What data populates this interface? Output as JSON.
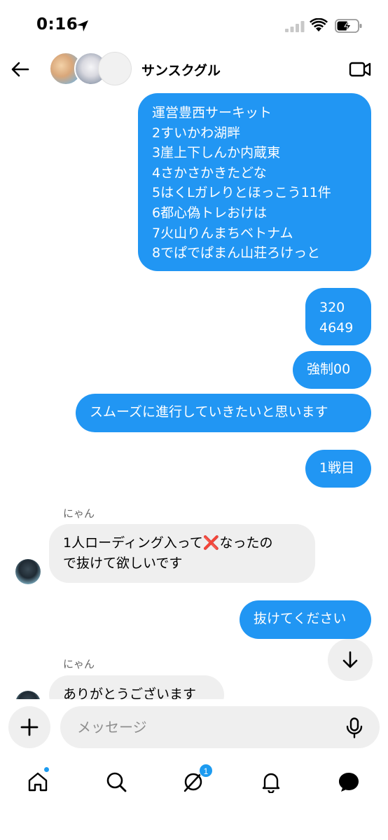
{
  "status_bar": {
    "time": "0:16",
    "icons": [
      "location-arrow-icon",
      "cellular-signal-icon",
      "wifi-icon",
      "battery-charging-icon"
    ]
  },
  "header": {
    "title": "サンスクグル",
    "back_icon": "arrow-left-icon",
    "video_icon": "video-camera-icon"
  },
  "messages": [
    {
      "direction": "outgoing",
      "lines": [
        "運営豊西サーキット",
        "2すいかわ湖畔",
        "3崖上下しんか内蔵東",
        "4さかさかきたどな",
        "5はくLガレりとほっこう11件",
        "6都心偽トレおけは",
        "7火山りんまちベトナム",
        "8でぱでぱまん山荘ろけっと"
      ]
    },
    {
      "direction": "outgoing",
      "lines": [
        "320",
        "4649"
      ]
    },
    {
      "direction": "outgoing",
      "lines": [
        "強制00"
      ]
    },
    {
      "direction": "outgoing",
      "lines": [
        "スムーズに進行していきたいと思います"
      ]
    },
    {
      "direction": "outgoing",
      "lines": [
        "1戦目"
      ]
    },
    {
      "direction": "incoming",
      "sender": "にゃん",
      "lines": [
        "1人ローディング入って❌なったの",
        "で抜けて欲しいです"
      ]
    },
    {
      "direction": "outgoing",
      "lines": [
        "抜けてください"
      ]
    },
    {
      "direction": "incoming",
      "sender": "にゃん",
      "lines": [
        "ありがとうございます"
      ]
    }
  ],
  "composer": {
    "placeholder": "メッセージ",
    "plus_icon": "plus-icon",
    "mic_icon": "microphone-icon"
  },
  "tab_bar": {
    "items": [
      {
        "name": "home",
        "icon": "home-icon",
        "has_dot": true
      },
      {
        "name": "search",
        "icon": "search-icon"
      },
      {
        "name": "grok",
        "icon": "grok-icon",
        "badge": "1"
      },
      {
        "name": "notifications",
        "icon": "bell-icon"
      },
      {
        "name": "messages",
        "icon": "chat-bubble-icon",
        "active": true
      }
    ]
  },
  "colors": {
    "outgoing_bubble": "#2196f3",
    "incoming_bubble": "#efefef",
    "accent": "#1d9bf0"
  }
}
